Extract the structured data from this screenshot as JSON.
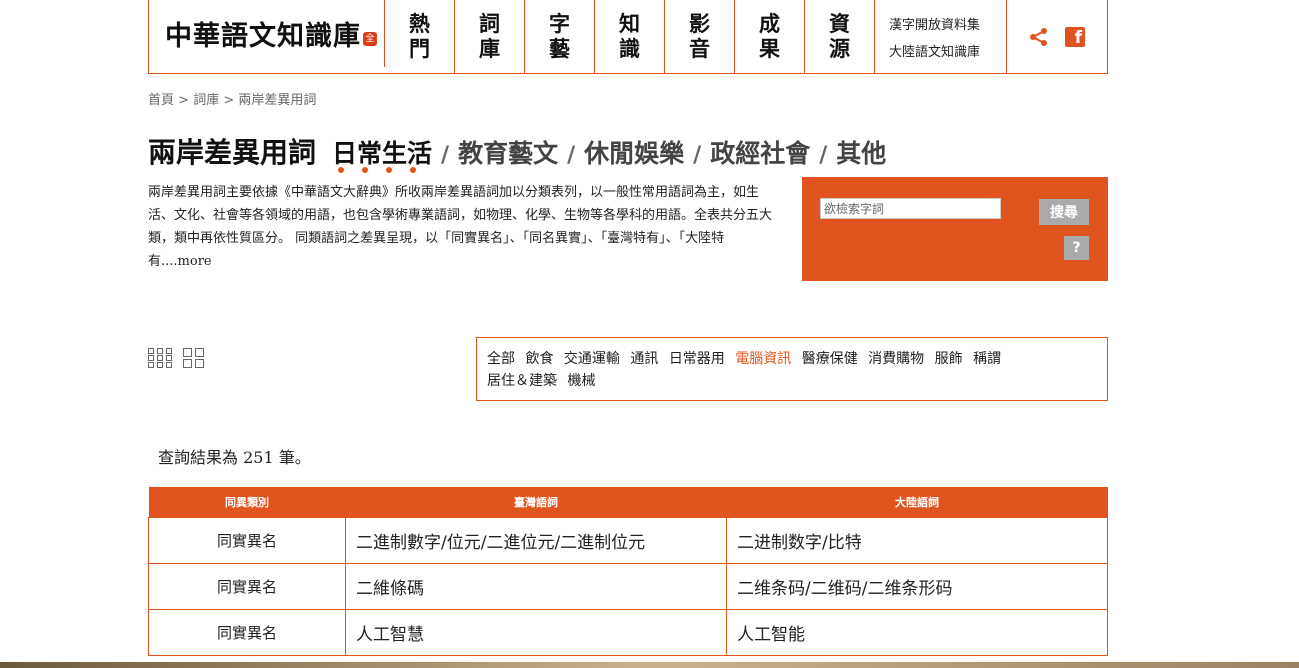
{
  "logo": {
    "text": "中華語文知識庫",
    "seal": "全"
  },
  "nav": [
    {
      "l1": "熱",
      "l2": "門"
    },
    {
      "l1": "詞",
      "l2": "庫"
    },
    {
      "l1": "字",
      "l2": "藝"
    },
    {
      "l1": "知",
      "l2": "識"
    },
    {
      "l1": "影",
      "l2": "音"
    },
    {
      "l1": "成",
      "l2": "果"
    },
    {
      "l1": "資",
      "l2": "源"
    }
  ],
  "side_links": [
    "漢字開放資料集",
    "大陸語文知識庫"
  ],
  "social": {
    "facebook_glyph": "f",
    "share_icon": "share-icon",
    "facebook_icon": "facebook-icon"
  },
  "breadcrumb": {
    "home": "首頁",
    "sep": " > ",
    "lexicon": "詞庫",
    "current": "兩岸差異用詞"
  },
  "page_title": "兩岸差異用詞",
  "categories": [
    "日常生活",
    "教育藝文",
    "休閒娛樂",
    "政經社會",
    "其他"
  ],
  "category_sep": "/",
  "intro": {
    "text": "兩岸差異用詞主要依據《中華語文大辭典》所收兩岸差異語詞加以分類表列，以一般性常用語詞為主，如生活、文化、社會等各領域的用語，也包含學術專業語詞，如物理、化學、生物等各學科的用語。全表共分五大類，類中再依性質區分。 同類語詞之差異呈現，以「同實異名」、「同名異實」、「臺灣特有」、「大陸特有",
    "more": "....more"
  },
  "search": {
    "placeholder": "欲檢索字詞",
    "button": "搜尋",
    "help": "?"
  },
  "subcategories": [
    "全部",
    "飲食",
    "交通運輸",
    "通訊",
    "日常器用",
    "電腦資訊",
    "醫療保健",
    "消費購物",
    "服飾",
    "稱謂",
    "居住＆建築",
    "機械"
  ],
  "result_text": "查詢結果為 251 筆。",
  "table": {
    "headers": [
      "同異類別",
      "臺灣語詞",
      "大陸語詞"
    ],
    "rows": [
      [
        "同實異名",
        "二進制數字/位元/二進位元/二進制位元",
        "二进制数字/比特"
      ],
      [
        "同實異名",
        "二維條碼",
        "二维条码/二维码/二维条形码"
      ],
      [
        "同實異名",
        "人工智慧",
        "人工智能"
      ]
    ]
  },
  "colors": {
    "accent": "#e0541f",
    "button_gray": "#aaaaaa"
  }
}
